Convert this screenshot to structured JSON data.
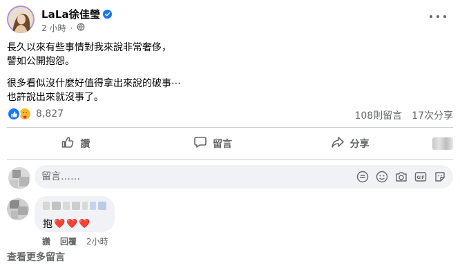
{
  "post": {
    "author": "LaLa徐佳瑩",
    "time": "2 小時",
    "paragraphs": [
      [
        "長久以來有些事情對我來說非常奢侈，",
        "譬如公開抱怨。"
      ],
      [
        "很多看似沒什麼好值得拿出來說的破事⋯",
        "也許說出來就沒事了。"
      ]
    ]
  },
  "stats": {
    "reactions": "8,827",
    "comments": "108則留言",
    "shares": "17次分享"
  },
  "actions": {
    "like": "讚",
    "comment": "留言",
    "share": "分享"
  },
  "composer": {
    "placeholder": "留言……"
  },
  "comment": {
    "text": "抱",
    "hearts": [
      "❤️",
      "❤️",
      "❤️"
    ],
    "like": "讚",
    "reply": "回覆",
    "time": "2小時"
  },
  "more_comments": "查看更多留言",
  "colors": {
    "brand": "#1877f2",
    "secondary_text": "#65676b",
    "heart": "#e41e3f"
  }
}
